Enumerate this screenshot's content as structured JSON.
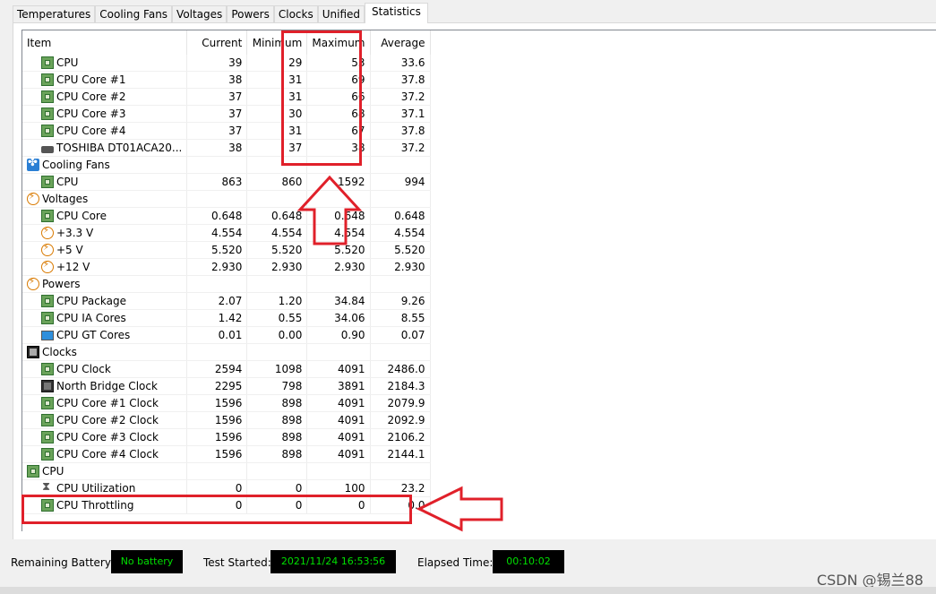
{
  "tabs": [
    "Temperatures",
    "Cooling Fans",
    "Voltages",
    "Powers",
    "Clocks",
    "Unified",
    "Statistics"
  ],
  "active_tab": "Statistics",
  "columns": [
    "Item",
    "Current",
    "Minimum",
    "Maximum",
    "Average"
  ],
  "rows": [
    {
      "level": 1,
      "icon": "chip-icon",
      "item": "CPU",
      "current": "39",
      "minimum": "29",
      "maximum": "53",
      "average": "33.6"
    },
    {
      "level": 1,
      "icon": "chip-icon",
      "item": "CPU Core #1",
      "current": "38",
      "minimum": "31",
      "maximum": "69",
      "average": "37.8"
    },
    {
      "level": 1,
      "icon": "chip-icon",
      "item": "CPU Core #2",
      "current": "37",
      "minimum": "31",
      "maximum": "66",
      "average": "37.2"
    },
    {
      "level": 1,
      "icon": "chip-icon",
      "item": "CPU Core #3",
      "current": "37",
      "minimum": "30",
      "maximum": "68",
      "average": "37.1"
    },
    {
      "level": 1,
      "icon": "chip-icon",
      "item": "CPU Core #4",
      "current": "37",
      "minimum": "31",
      "maximum": "67",
      "average": "37.8"
    },
    {
      "level": 1,
      "icon": "disk-icon",
      "item": "TOSHIBA DT01ACA20...",
      "current": "38",
      "minimum": "37",
      "maximum": "38",
      "average": "37.2"
    },
    {
      "level": 0,
      "icon": "fan-icon",
      "item": "Cooling Fans",
      "current": "",
      "minimum": "",
      "maximum": "",
      "average": ""
    },
    {
      "level": 1,
      "icon": "chip-icon",
      "item": "CPU",
      "current": "863",
      "minimum": "860",
      "maximum": "1592",
      "average": "994"
    },
    {
      "level": 0,
      "icon": "bolt-icon",
      "item": "Voltages",
      "current": "",
      "minimum": "",
      "maximum": "",
      "average": ""
    },
    {
      "level": 1,
      "icon": "chip-icon",
      "item": "CPU Core",
      "current": "0.648",
      "minimum": "0.648",
      "maximum": "0.648",
      "average": "0.648"
    },
    {
      "level": 1,
      "icon": "bolt-icon",
      "item": "+3.3 V",
      "current": "4.554",
      "minimum": "4.554",
      "maximum": "4.554",
      "average": "4.554"
    },
    {
      "level": 1,
      "icon": "bolt-icon",
      "item": "+5 V",
      "current": "5.520",
      "minimum": "5.520",
      "maximum": "5.520",
      "average": "5.520"
    },
    {
      "level": 1,
      "icon": "bolt-icon",
      "item": "+12 V",
      "current": "2.930",
      "minimum": "2.930",
      "maximum": "2.930",
      "average": "2.930"
    },
    {
      "level": 0,
      "icon": "bolt-icon",
      "item": "Powers",
      "current": "",
      "minimum": "",
      "maximum": "",
      "average": ""
    },
    {
      "level": 1,
      "icon": "chip-icon",
      "item": "CPU Package",
      "current": "2.07",
      "minimum": "1.20",
      "maximum": "34.84",
      "average": "9.26"
    },
    {
      "level": 1,
      "icon": "chip-icon",
      "item": "CPU IA Cores",
      "current": "1.42",
      "minimum": "0.55",
      "maximum": "34.06",
      "average": "8.55"
    },
    {
      "level": 1,
      "icon": "monitor-icon",
      "item": "CPU GT Cores",
      "current": "0.01",
      "minimum": "0.00",
      "maximum": "0.90",
      "average": "0.07"
    },
    {
      "level": 0,
      "icon": "clock-icon",
      "item": "Clocks",
      "current": "",
      "minimum": "",
      "maximum": "",
      "average": ""
    },
    {
      "level": 1,
      "icon": "chip-icon",
      "item": "CPU Clock",
      "current": "2594",
      "minimum": "1098",
      "maximum": "4091",
      "average": "2486.0"
    },
    {
      "level": 1,
      "icon": "nb-icon",
      "item": "North Bridge Clock",
      "current": "2295",
      "minimum": "798",
      "maximum": "3891",
      "average": "2184.3"
    },
    {
      "level": 1,
      "icon": "chip-icon",
      "item": "CPU Core #1 Clock",
      "current": "1596",
      "minimum": "898",
      "maximum": "4091",
      "average": "2079.9"
    },
    {
      "level": 1,
      "icon": "chip-icon",
      "item": "CPU Core #2 Clock",
      "current": "1596",
      "minimum": "898",
      "maximum": "4091",
      "average": "2092.9"
    },
    {
      "level": 1,
      "icon": "chip-icon",
      "item": "CPU Core #3 Clock",
      "current": "1596",
      "minimum": "898",
      "maximum": "4091",
      "average": "2106.2"
    },
    {
      "level": 1,
      "icon": "chip-icon",
      "item": "CPU Core #4 Clock",
      "current": "1596",
      "minimum": "898",
      "maximum": "4091",
      "average": "2144.1"
    },
    {
      "level": 0,
      "icon": "chip-icon",
      "item": "CPU",
      "current": "",
      "minimum": "",
      "maximum": "",
      "average": ""
    },
    {
      "level": 1,
      "icon": "hourglass-icon",
      "item": "CPU Utilization",
      "current": "0",
      "minimum": "0",
      "maximum": "100",
      "average": "23.2"
    },
    {
      "level": 1,
      "icon": "chip-icon",
      "item": "CPU Throttling",
      "current": "0",
      "minimum": "0",
      "maximum": "0",
      "average": "0.0"
    }
  ],
  "status": {
    "battery_label": "Remaining Battery:",
    "battery_value": "No battery",
    "test_label": "Test Started:",
    "test_value": "2021/11/24 16:53:56",
    "elapsed_label": "Elapsed Time:",
    "elapsed_value": "00:10:02"
  },
  "watermark": "CSDN @锡兰88",
  "annotation_color": "#e0202a"
}
